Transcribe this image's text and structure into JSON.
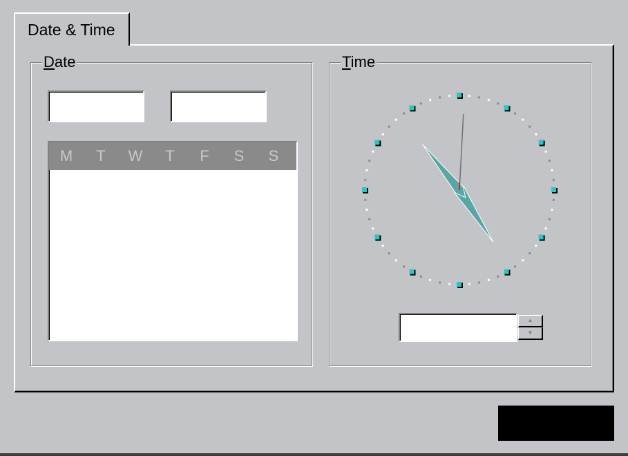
{
  "tab": {
    "label": "Date & Time"
  },
  "date_group": {
    "title": "Date",
    "mnemonic": "D",
    "month_value": "",
    "year_value": "",
    "calendar": {
      "day_headers": [
        "M",
        "T",
        "W",
        "T",
        "F",
        "S",
        "S"
      ]
    }
  },
  "time_group": {
    "title": "Time",
    "mnemonic": "T",
    "time_value": "",
    "clock": {
      "hour": 4.9,
      "minute": 53.5,
      "second": 0.5
    }
  },
  "colors": {
    "face_marker": "#28c8c8",
    "hand_fill": "#5aa6a6",
    "second_hand": "#d03030",
    "background": "#c3c4c8"
  }
}
